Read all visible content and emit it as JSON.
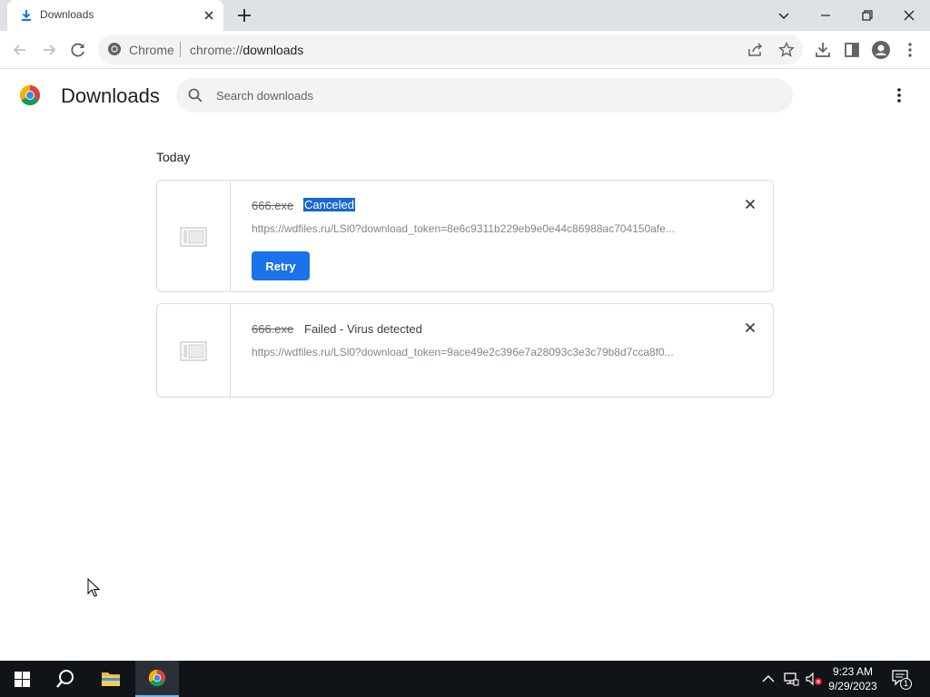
{
  "browser": {
    "tab": {
      "title": "Downloads"
    },
    "omnibox": {
      "site_label": "Chrome",
      "url_scheme": "chrome://",
      "url_path": "downloads"
    }
  },
  "downloads": {
    "title": "Downloads",
    "search": {
      "placeholder": "Search downloads",
      "value": ""
    },
    "section": "Today",
    "items": [
      {
        "file_name": "666.exe",
        "status": "Canceled",
        "url": "https://wdfiles.ru/LSl0?download_token=8e6c9311b229eb9e0e44c86988ac704150afe...",
        "action_label": "Retry"
      },
      {
        "file_name": "666.exe",
        "status": "Failed - Virus detected",
        "url": "https://wdfiles.ru/LSl0?download_token=9ace49e2c396e7a28093c3e3c79b8d7cca8f0..."
      }
    ]
  },
  "taskbar": {
    "time": "9:23 AM",
    "date": "9/29/2023",
    "notification_count": "1",
    "pinned": [
      "start-icon",
      "search-icon",
      "file-explorer-icon",
      "chrome-icon"
    ]
  },
  "colors": {
    "accent": "#1a73e8",
    "selection": "#1967d2",
    "taskbar": "#101418",
    "tabstrip": "#dee1e6"
  }
}
